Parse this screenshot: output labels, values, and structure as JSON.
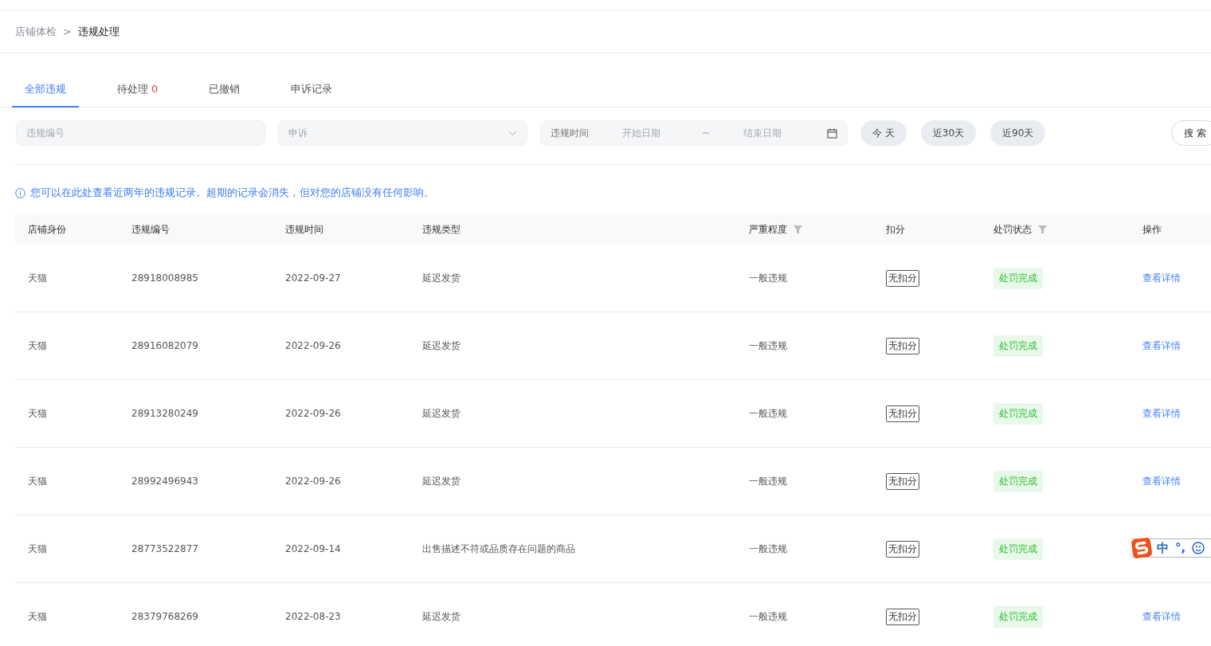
{
  "breadcrumb": {
    "parent": "店铺体检",
    "separator": ">",
    "current": "违规处理"
  },
  "tabs": [
    {
      "label": "全部违规",
      "selected": true
    },
    {
      "label": "待处理",
      "count": "0",
      "selected": false
    },
    {
      "label": "已撤销",
      "selected": false
    },
    {
      "label": "申诉记录",
      "selected": false
    }
  ],
  "filters": {
    "id_placeholder": "违规编号",
    "appeal_placeholder": "申诉",
    "date_label": "违规时间",
    "start_placeholder": "开始日期",
    "range_separator": "~",
    "end_placeholder": "结束日期",
    "quick_ranges": [
      "今 天",
      "近30天",
      "近90天"
    ],
    "search_button": "搜 索"
  },
  "notice": "您可以在此处查看近两年的违规记录。超期的记录会消失，但对您的店铺没有任何影响。",
  "table": {
    "columns": [
      {
        "label": "店铺身份",
        "filter": false
      },
      {
        "label": "违规编号",
        "filter": false
      },
      {
        "label": "违规时间",
        "filter": false
      },
      {
        "label": "违规类型",
        "filter": false
      },
      {
        "label": "严重程度",
        "filter": true
      },
      {
        "label": "扣分",
        "filter": false
      },
      {
        "label": "处罚状态",
        "filter": true
      },
      {
        "label": "操作",
        "filter": false
      }
    ],
    "rows": [
      {
        "shop": "天猫",
        "id": "28918008985",
        "date": "2022-09-27",
        "type": "延迟发货",
        "severity": "一般违规",
        "points": "无扣分",
        "status": "处罚完成",
        "action": "查看详情"
      },
      {
        "shop": "天猫",
        "id": "28916082079",
        "date": "2022-09-26",
        "type": "延迟发货",
        "severity": "一般违规",
        "points": "无扣分",
        "status": "处罚完成",
        "action": "查看详情"
      },
      {
        "shop": "天猫",
        "id": "28913280249",
        "date": "2022-09-26",
        "type": "延迟发货",
        "severity": "一般违规",
        "points": "无扣分",
        "status": "处罚完成",
        "action": "查看详情"
      },
      {
        "shop": "天猫",
        "id": "28992496943",
        "date": "2022-09-26",
        "type": "延迟发货",
        "severity": "一般违规",
        "points": "无扣分",
        "status": "处罚完成",
        "action": "查看详情"
      },
      {
        "shop": "天猫",
        "id": "28773522877",
        "date": "2022-09-14",
        "type": "出售描述不符或品质存在问题的商品",
        "severity": "一般违规",
        "points": "无扣分",
        "status": "处罚完成"
      },
      {
        "shop": "天猫",
        "id": "28379768269",
        "date": "2022-08-23",
        "type": "延迟发货",
        "severity": "一般违规",
        "points": "无扣分",
        "status": "处罚完成",
        "action": "查看详情"
      }
    ]
  },
  "ime_bar": {
    "mode": "中",
    "punctuation": "°,"
  }
}
